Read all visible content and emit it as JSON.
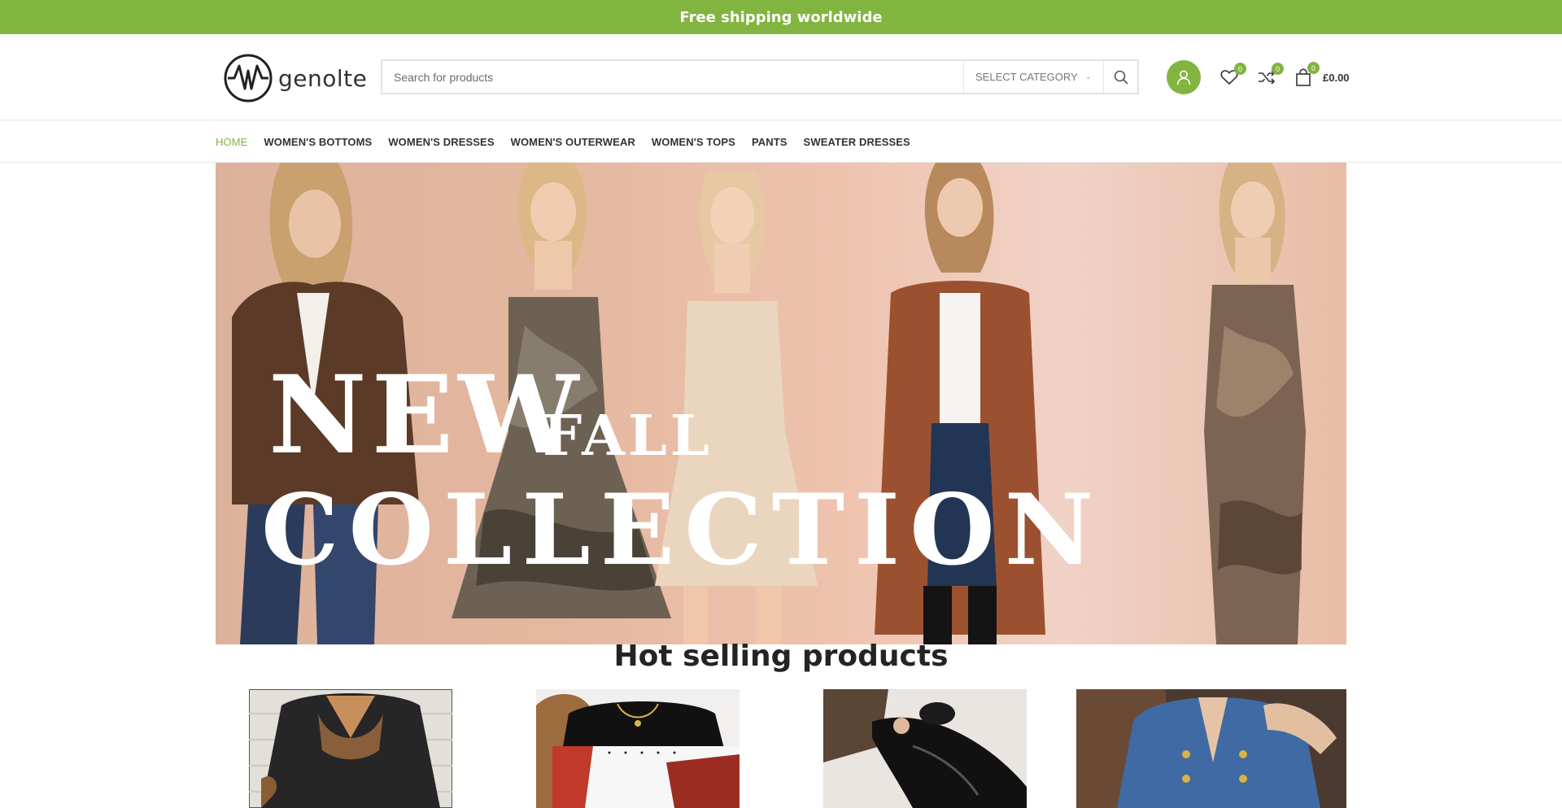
{
  "announcement": {
    "text": "Free shipping worldwide",
    "left_glyph": "",
    "right_glyph": ""
  },
  "brand": {
    "name": "genolte",
    "accent_color": "#82b440"
  },
  "search": {
    "placeholder": "Search for products",
    "category_label": "SELECT CATEGORY",
    "icon": "search-icon"
  },
  "header_icons": {
    "account_icon": "user-icon",
    "wishlist_count": "0",
    "compare_count": "0",
    "cart_count": "0",
    "cart_total": "£0.00"
  },
  "nav": {
    "items": [
      {
        "label": "HOME"
      },
      {
        "label": "WOMEN'S BOTTOMS"
      },
      {
        "label": "WOMEN'S DRESSES"
      },
      {
        "label": "WOMEN'S OUTERWEAR"
      },
      {
        "label": "WOMEN'S TOPS"
      },
      {
        "label": "PANTS"
      },
      {
        "label": "SWEATER DRESSES"
      }
    ]
  },
  "hero": {
    "line1": "NEW",
    "line1b": "FALL",
    "line2": "COLLECTION"
  },
  "section": {
    "title": "Hot selling products"
  }
}
